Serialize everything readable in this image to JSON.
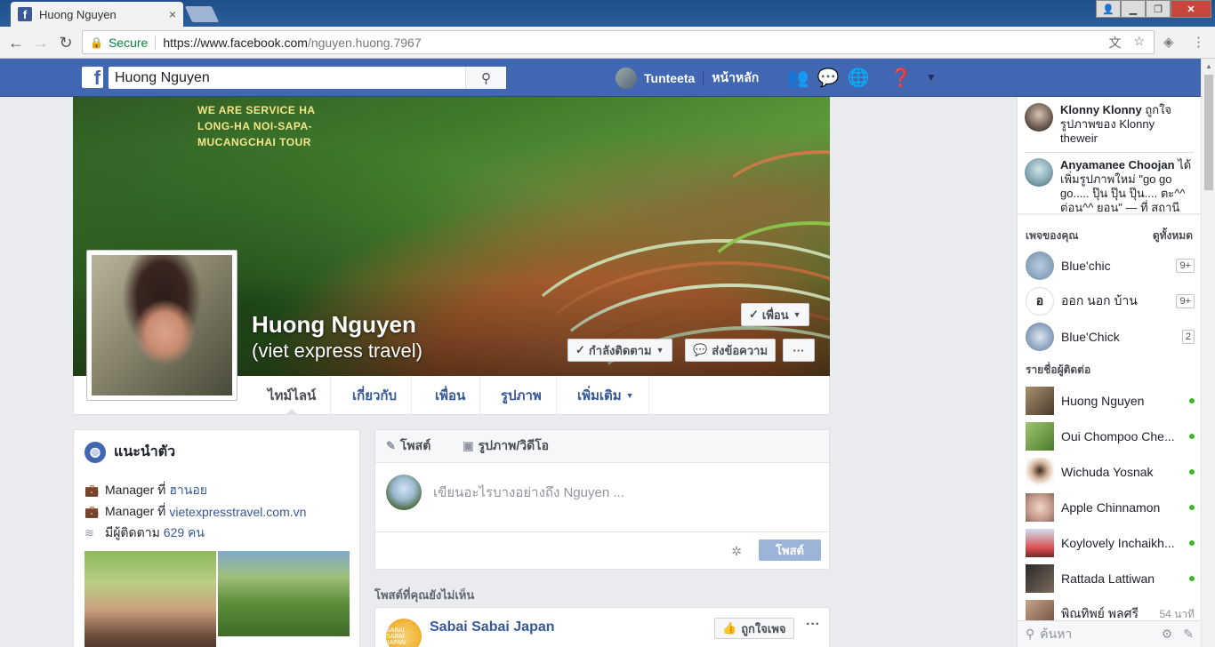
{
  "browser": {
    "tab_title": "Huong Nguyen",
    "tab_close": "×",
    "secure_label": "Secure",
    "url_host": "https://www.facebook.com",
    "url_path": "/nguyen.huong.7967"
  },
  "fb": {
    "logo": "f",
    "search_value": "Huong Nguyen",
    "user_name": "Tunteeta",
    "home": "หน้าหลัก"
  },
  "cover": {
    "text_line1": "WE ARE SERVICE HA",
    "text_line2": "LONG-HA NOI-SAPA-",
    "text_line3": "MUCANGCHAI TOUR"
  },
  "profile": {
    "name": "Huong Nguyen",
    "alternate": "(viet express travel)",
    "friend_btn": "เพื่อน",
    "follow_btn": "กำลังติดตาม",
    "message_btn": "ส่งข้อความ",
    "more_btn": "···",
    "tabs": [
      "ไทม์ไลน์",
      "เกี่ยวกับ",
      "เพื่อน",
      "รูปภาพ",
      "เพิ่มเติม"
    ]
  },
  "intro": {
    "title": "แนะนำตัว",
    "row1_text": "Manager ที่",
    "row1_link": "ฮานอย",
    "row2_text": "Manager ที่",
    "row2_link": "vietexpresstravel.com.vn",
    "row3_text": "มีผู้ติดตาม",
    "row3_link": "629 คน"
  },
  "composer": {
    "tab_post": "โพสต์",
    "tab_photo": "รูปภาพ/วิดีโอ",
    "placeholder": "เขียนอะไรบางอย่างถึง Nguyen ...",
    "post_button": "โพสต์"
  },
  "feed": {
    "unseen_label": "โพสต์ที่คุณยังไม่เห็น",
    "card_name": "Sabai Sabai Japan",
    "card_avatar_text": "SABAI SABAI JAPAN",
    "like_page": "ถูกใจเพจ",
    "more": "···"
  },
  "ticker": [
    {
      "name": "Klonny Klonny",
      "text": " ถูกใจรูปภาพของ Klonny theweir"
    },
    {
      "name": "Anyamanee Choojan",
      "text": " ได้เพิ่มรูปภาพใหม่ \"go go go..... ปุ๊น ปุ๊น ปุ๊น.... ตะ^^ ต่อน^^ ยอน\" — ที่ สถานี"
    }
  ],
  "pages_section": {
    "title": "เพจของคุณ",
    "see_all": "ดูทั้งหมด",
    "items": [
      {
        "name": "Blue'chic",
        "badge": "9+"
      },
      {
        "name": "ออก นอก บ้าน",
        "badge": "9+"
      },
      {
        "name": "Blue'Chick",
        "badge": "2"
      }
    ]
  },
  "contacts_section": {
    "title": "รายชื่อผู้ติดต่อ",
    "items": [
      {
        "name": "Huong Nguyen",
        "status": "online"
      },
      {
        "name": "Oui Chompoo Che...",
        "status": "online"
      },
      {
        "name": "Wichuda Yosnak",
        "status": "online"
      },
      {
        "name": "Apple Chinnamon",
        "status": "online"
      },
      {
        "name": "Koylovely Inchaikh...",
        "status": "online"
      },
      {
        "name": "Rattada Lattiwan",
        "status": "online"
      },
      {
        "name": "พิณทิพย์ พลศรี",
        "status": "54 นาที"
      }
    ]
  },
  "chat_search_placeholder": "ค้นหา",
  "colors": {
    "fb_blue": "#4267b2",
    "link": "#365899",
    "online": "#42b72a"
  }
}
